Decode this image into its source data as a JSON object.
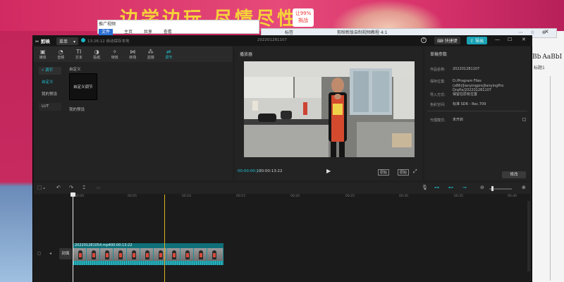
{
  "desktop": {
    "banner_text": "边学边玩 尽情尽性",
    "badge_text": "让99%",
    "badge_sub": "挑战",
    "word_styles": [
      "Bb",
      "AaBbI"
    ],
    "word_sub": "标题1"
  },
  "explorer": {
    "title": "推广视频",
    "tabs": [
      {
        "label": "文件",
        "active": true
      },
      {
        "label": "主页"
      },
      {
        "label": "共享"
      },
      {
        "label": "查看"
      }
    ]
  },
  "browser": {
    "tab1": "标签",
    "tab2": "剪映新版自制视频教程 4:1",
    "icons": "⋯ ☆ ⊕",
    "close": "×"
  },
  "app": {
    "logo": "剪映",
    "menu_label": "菜单",
    "autosave_text": "13:26:12 自动保存本地",
    "project_title": "202201281107",
    "shortcut_label": "快捷键",
    "export_label": "导出",
    "help": "?",
    "win_min": "—",
    "win_max": "☐",
    "win_close": "✕"
  },
  "media": {
    "tools": [
      {
        "label": "媒体",
        "icon": "▣",
        "icon_name": "media-icon"
      },
      {
        "label": "音频",
        "icon": "◔",
        "icon_name": "audio-icon"
      },
      {
        "label": "文本",
        "icon": "TI",
        "icon_name": "text-icon"
      },
      {
        "label": "贴纸",
        "icon": "◑",
        "icon_name": "sticker-icon"
      },
      {
        "label": "特效",
        "icon": "✧",
        "icon_name": "effects-icon"
      },
      {
        "label": "转场",
        "icon": "⋈",
        "icon_name": "transition-icon"
      },
      {
        "label": "滤镜",
        "icon": "⁂",
        "icon_name": "filter-icon"
      },
      {
        "label": "调节",
        "icon": "⇌",
        "icon_name": "adjust-icon",
        "active": true
      }
    ],
    "side": [
      "• 调节",
      "自定义",
      "我的预设",
      "LUT"
    ],
    "section_custom": "自定义",
    "custom_card": "自定义调节",
    "section_mine": "我的预设"
  },
  "player": {
    "title": "播放器",
    "time_current": "00:00:00:10",
    "time_total": "00:00:13:22",
    "play": "▶",
    "original_label": "原始",
    "ratio_label": "原始",
    "fullscreen": "⤢"
  },
  "details": {
    "title": "草稿参数",
    "rows": [
      {
        "label": "作品名称:",
        "value": "202201281107"
      },
      {
        "label": "保存位置:",
        "value": "D:/Program Files (x86)/Jianyingpro/JianyingPro Drafts/202201281107"
      },
      {
        "label": "导入方式:",
        "value": "保留在原有位置"
      },
      {
        "label": "色彩空间:",
        "value": "标准 SDR - Rec.709"
      }
    ],
    "proxy_label": "代理模式:",
    "proxy_value": "未开启",
    "modify_label": "修改"
  },
  "timeline": {
    "ticks": [
      "00:00",
      "00:05",
      "00:10",
      "00:15",
      "00:20",
      "00:25",
      "00:30",
      "00:35",
      "00:40"
    ],
    "clip_name": "202201281054.mp4",
    "clip_duration": "00:00:13:22",
    "cover_label": "封面",
    "tool_icons": {
      "select": "⬚⌄",
      "undo": "↶",
      "redo": "↷",
      "split": "⌶",
      "delete": "▭",
      "mic": "🎙",
      "link1": "⊶",
      "link2": "⊷",
      "link3": "⊸",
      "zoom_out": "⊖",
      "zoom_in": "⊕"
    }
  },
  "colors": {
    "accent": "#1fc3d4",
    "export": "#19a3b5",
    "panel": "#232323",
    "clip": "#1f8f98"
  }
}
